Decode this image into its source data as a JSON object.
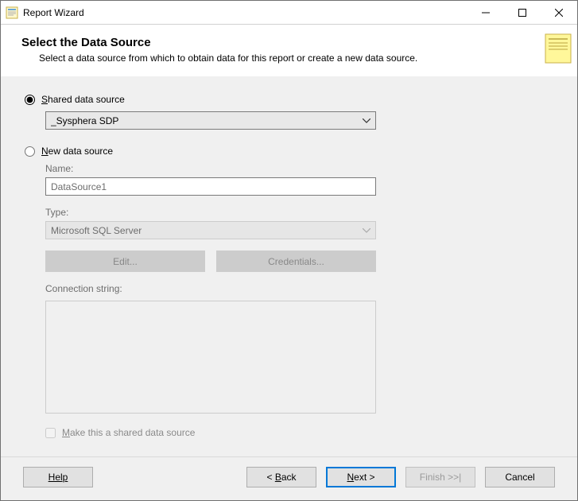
{
  "window": {
    "title": "Report Wizard"
  },
  "banner": {
    "heading": "Select the Data Source",
    "subtext": "Select a data source from which to obtain data for this report or create a new data source."
  },
  "form": {
    "shared_label": "Shared data source",
    "shared_selected": "_Sysphera SDP",
    "new_label": "New data source",
    "name_label": "Name:",
    "name_value": "DataSource1",
    "type_label": "Type:",
    "type_value": "Microsoft SQL Server",
    "edit_btn": "Edit...",
    "credentials_btn": "Credentials...",
    "connstr_label": "Connection string:",
    "connstr_value": "",
    "make_shared_label": "Make this a shared data source"
  },
  "footer": {
    "help": "Help",
    "back": "< Back",
    "next": "Next >",
    "finish": "Finish >>|",
    "cancel": "Cancel"
  }
}
